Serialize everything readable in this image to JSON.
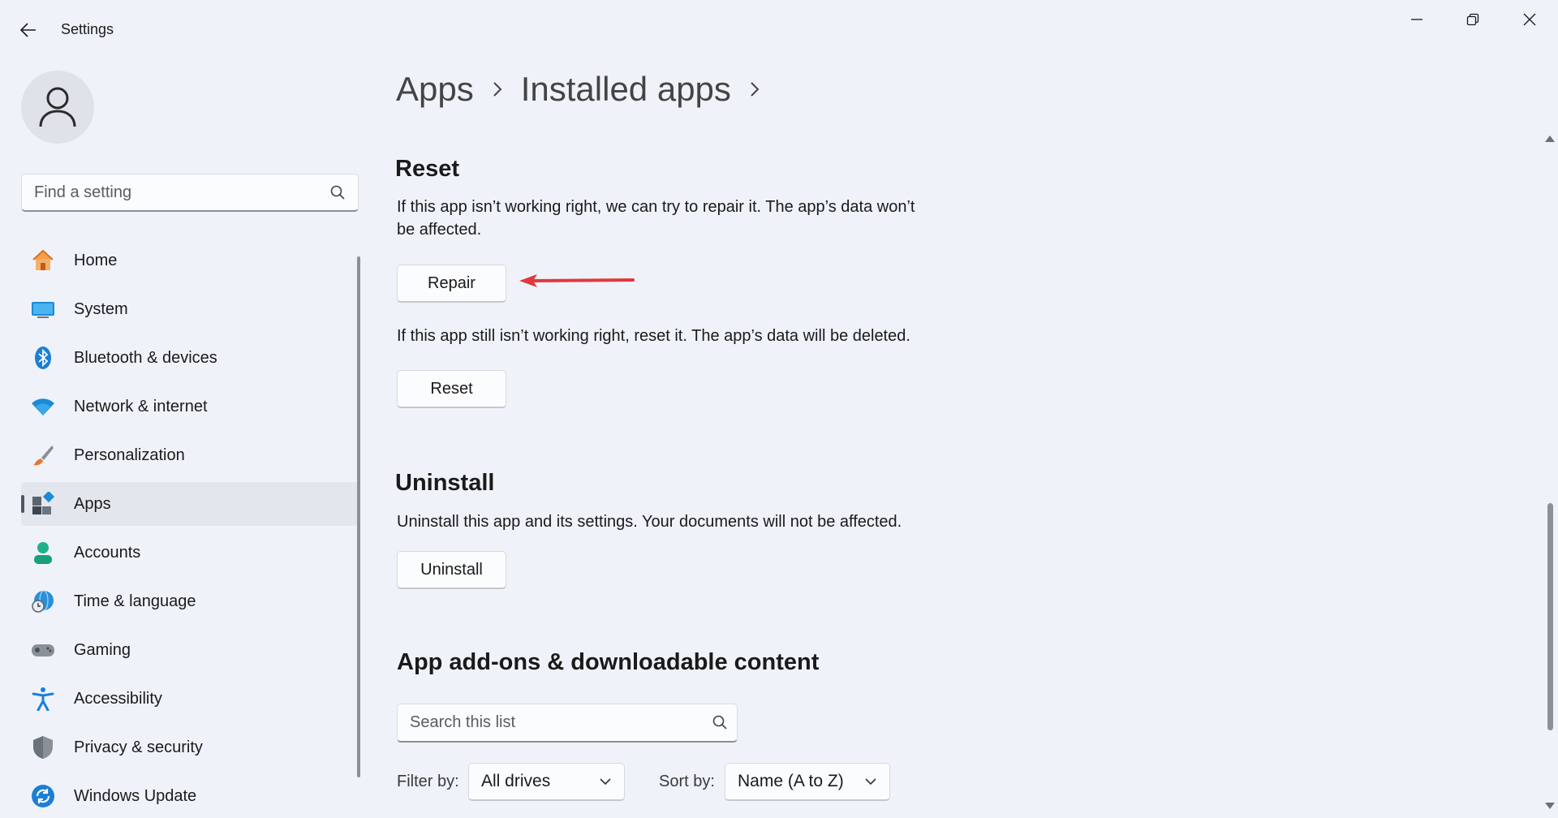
{
  "window": {
    "title": "Settings",
    "icons": {
      "back": "back-arrow-icon",
      "minimize": "minimize-icon",
      "maximize": "restore-icon",
      "close": "close-icon"
    }
  },
  "sidebar": {
    "search_placeholder": "Find a setting",
    "items": [
      {
        "label": "Home",
        "icon": "home-icon"
      },
      {
        "label": "System",
        "icon": "system-icon"
      },
      {
        "label": "Bluetooth & devices",
        "icon": "bluetooth-icon"
      },
      {
        "label": "Network & internet",
        "icon": "wifi-icon"
      },
      {
        "label": "Personalization",
        "icon": "paintbrush-icon"
      },
      {
        "label": "Apps",
        "icon": "apps-icon",
        "active": true
      },
      {
        "label": "Accounts",
        "icon": "accounts-icon"
      },
      {
        "label": "Time & language",
        "icon": "globe-clock-icon"
      },
      {
        "label": "Gaming",
        "icon": "gamepad-icon"
      },
      {
        "label": "Accessibility",
        "icon": "accessibility-icon"
      },
      {
        "label": "Privacy & security",
        "icon": "shield-icon"
      },
      {
        "label": "Windows Update",
        "icon": "update-icon"
      }
    ]
  },
  "breadcrumb": {
    "items": [
      "Apps",
      "Installed apps"
    ]
  },
  "reset_section": {
    "title": "Reset",
    "repair_desc": "If this app isn’t working right, we can try to repair it. The app’s data won’t be affected.",
    "repair_button": "Repair",
    "reset_desc": "If this app still isn’t working right, reset it. The app’s data will be deleted.",
    "reset_button": "Reset"
  },
  "uninstall_section": {
    "title": "Uninstall",
    "desc": "Uninstall this app and its settings. Your documents will not be affected.",
    "button": "Uninstall"
  },
  "addons_section": {
    "title": "App add-ons & downloadable content",
    "search_placeholder": "Search this list",
    "filter_label": "Filter by:",
    "filter_value": "All drives",
    "sort_label": "Sort by:",
    "sort_value": "Name (A to Z)"
  },
  "colors": {
    "annotation_arrow": "#e0393e",
    "accent": "#0067c0"
  }
}
